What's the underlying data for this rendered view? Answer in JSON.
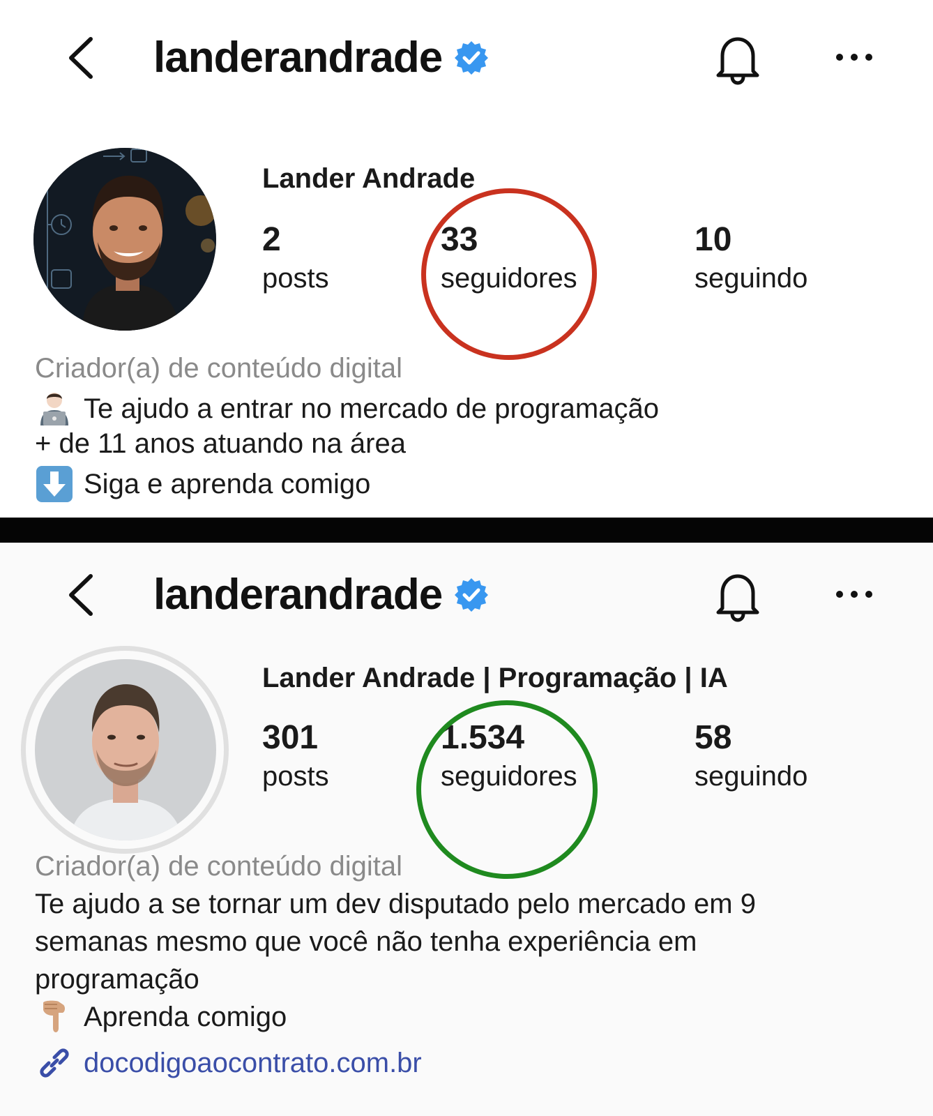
{
  "before": {
    "username": "landerandrade",
    "display_name": "Lander Andrade",
    "stats": {
      "posts_value": "2",
      "posts_label": "posts",
      "followers_value": "33",
      "followers_label": "seguidores",
      "following_value": "10",
      "following_label": "seguindo"
    },
    "category": "Criador(a) de conteúdo digital",
    "bio": [
      "Te ajudo a entrar no mercado de programação",
      "+ de 11 anos atuando na área",
      "Siga e aprenda comigo"
    ],
    "highlight_color": "#c9321f"
  },
  "after": {
    "username": "landerandrade",
    "display_name": "Lander Andrade | Programação | IA",
    "stats": {
      "posts_value": "301",
      "posts_label": "posts",
      "followers_value": "1.534",
      "followers_label": "seguidores",
      "following_value": "58",
      "following_label": "seguindo"
    },
    "category": "Criador(a) de conteúdo digital",
    "bio": [
      "Te ajudo a se tornar um dev disputado pelo mercado em 9",
      "semanas mesmo que você não tenha experiência em",
      "programação",
      "Aprenda comigo"
    ],
    "link": "docodigoaocontrato.com.br",
    "highlight_color": "#1f8a1f"
  },
  "icons": {
    "back": "chevron-left-icon",
    "verified": "verified-badge-icon",
    "bell": "bell-icon",
    "more": "more-horizontal-icon",
    "link": "link-icon"
  },
  "colors": {
    "verified_blue": "#3897f0",
    "link_blue": "#3a4ea8",
    "category_gray": "#8a8a8a"
  }
}
